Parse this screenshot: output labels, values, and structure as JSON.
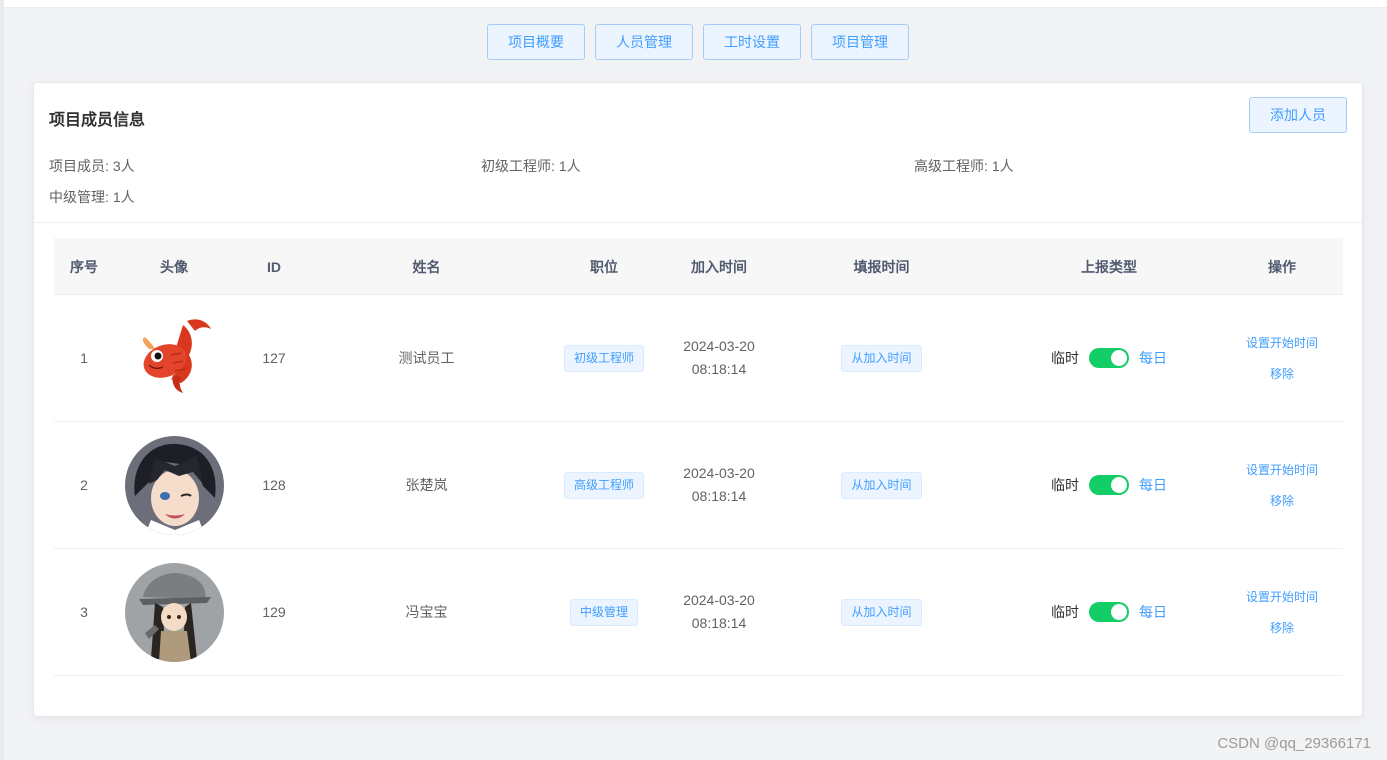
{
  "tabs": [
    "项目概要",
    "人员管理",
    "工时设置",
    "项目管理"
  ],
  "card": {
    "title": "项目成员信息",
    "add_button": "添加人员",
    "stats": [
      {
        "label": "项目成员:",
        "value": "3人"
      },
      {
        "label": "初级工程师:",
        "value": "1人"
      },
      {
        "label": "高级工程师:",
        "value": "1人"
      },
      {
        "label": "中级管理:",
        "value": "1人"
      }
    ]
  },
  "table": {
    "headers": [
      "序号",
      "头像",
      "ID",
      "姓名",
      "职位",
      "加入时间",
      "填报时间",
      "上报类型",
      "操作"
    ],
    "rows": [
      {
        "index": "1",
        "avatar": "koi-fish-avatar",
        "id": "127",
        "name": "测试员工",
        "position": "初级工程师",
        "join_date": "2024-03-20",
        "join_time": "08:18:14",
        "fill_time": "从加入时间",
        "switch_left": "临时",
        "switch_right": "每日",
        "op_set": "设置开始时间",
        "op_remove": "移除"
      },
      {
        "index": "2",
        "avatar": "anime-boy-avatar",
        "id": "128",
        "name": "张楚岚",
        "position": "高级工程师",
        "join_date": "2024-03-20",
        "join_time": "08:18:14",
        "fill_time": "从加入时间",
        "switch_left": "临时",
        "switch_right": "每日",
        "op_set": "设置开始时间",
        "op_remove": "移除"
      },
      {
        "index": "3",
        "avatar": "anime-girl-avatar",
        "id": "129",
        "name": "冯宝宝",
        "position": "中级管理",
        "join_date": "2024-03-20",
        "join_time": "08:18:14",
        "fill_time": "从加入时间",
        "switch_left": "临时",
        "switch_right": "每日",
        "op_set": "设置开始时间",
        "op_remove": "移除"
      }
    ]
  },
  "watermark": "CSDN @qq_29366171",
  "colors": {
    "primary": "#409eff",
    "switch_on": "#13ce66",
    "tag_bg": "#ecf5ff"
  }
}
